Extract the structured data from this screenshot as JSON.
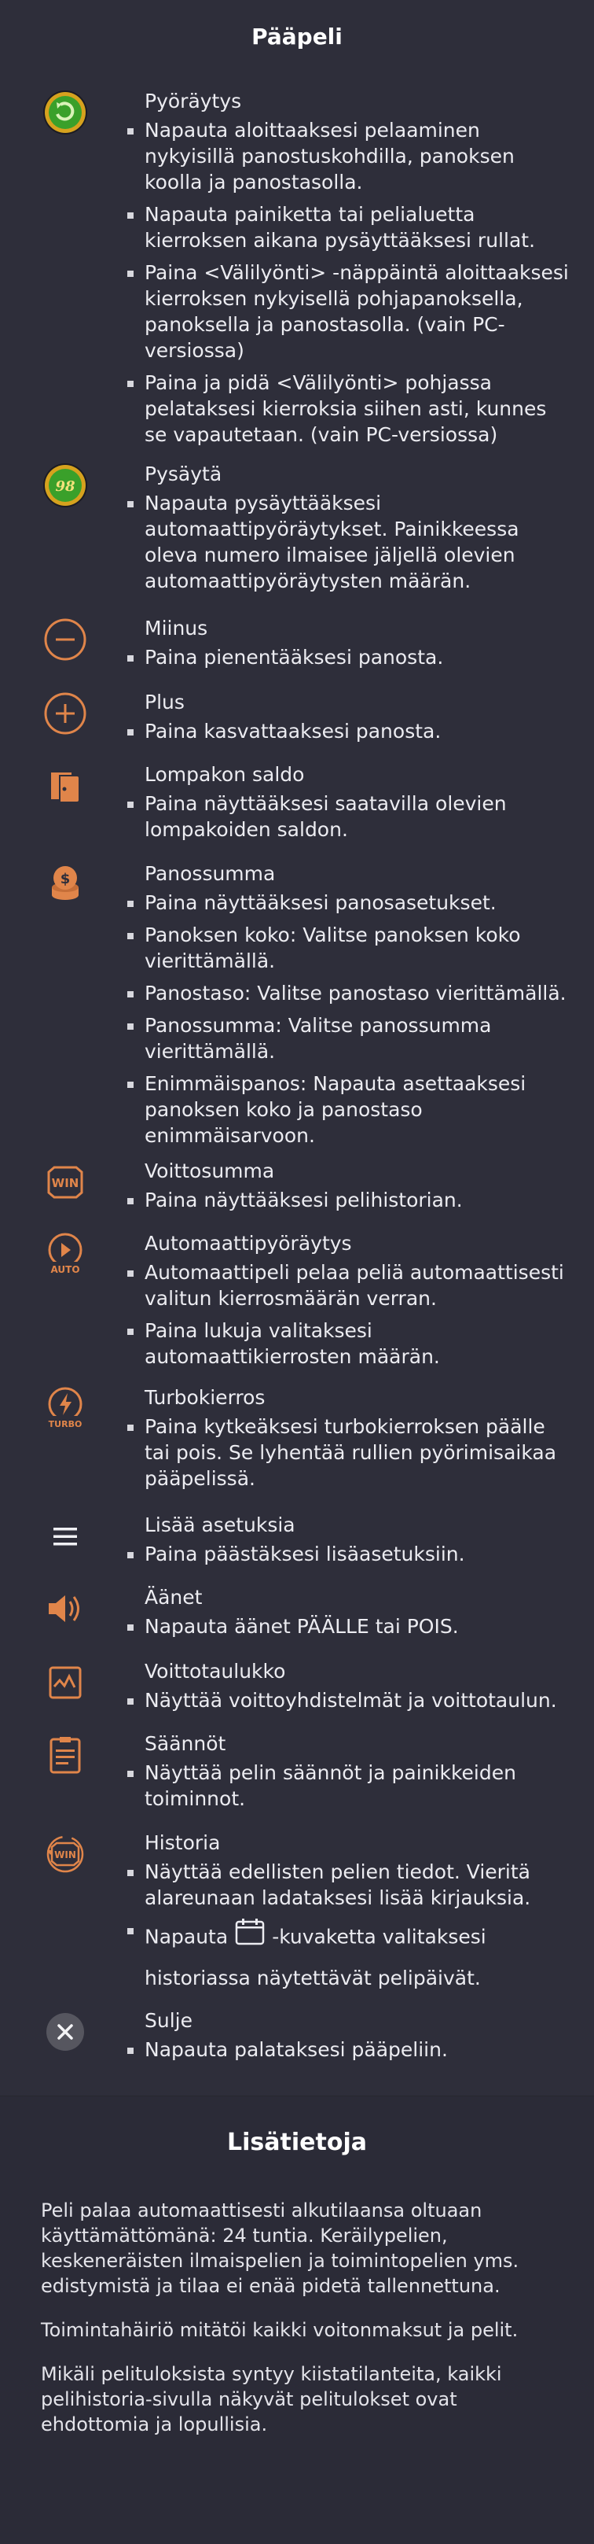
{
  "main": {
    "title": "Pääpeli",
    "sections": [
      {
        "icon": "spin-icon",
        "title": "Pyöräytys",
        "items": [
          "Napauta aloittaaksesi pelaaminen nykyisillä panostuskohdilla, panoksen koolla ja panostasolla.",
          "Napauta painiketta tai pelialuetta kierroksen aikana pysäyttääksesi rullat.",
          "Paina <Välilyönti> -näppäintä aloittaaksesi kierroksen nykyisellä pohjapanoksella, panoksella ja panostasolla. (vain PC-versiossa)",
          "Paina ja pidä <Välilyönti> pohjassa pelataksesi kierroksia siihen asti, kunnes se vapautetaan. (vain PC-versiossa)"
        ]
      },
      {
        "icon": "stop-autospin-icon",
        "icon_text": "98",
        "title": "Pysäytä",
        "items": [
          "Napauta pysäyttääksesi automaattipyöräytykset. Painikkeessa oleva numero ilmaisee jäljellä olevien automaattipyöräytysten määrän."
        ]
      },
      {
        "icon": "minus-icon",
        "title": "Miinus",
        "items": [
          "Paina pienentääksesi panosta."
        ]
      },
      {
        "icon": "plus-icon",
        "title": "Plus",
        "items": [
          "Paina kasvattaaksesi panosta."
        ]
      },
      {
        "icon": "wallet-icon",
        "title": "Lompakon saldo",
        "items": [
          "Paina näyttääksesi saatavilla olevien lompakoiden saldon."
        ]
      },
      {
        "icon": "coins-icon",
        "title": "Panossumma",
        "items": [
          "Paina näyttääksesi panosasetukset.",
          "Panoksen koko: Valitse panoksen koko vierittämällä.",
          "Panostaso: Valitse panostaso vierittämällä.",
          "Panossumma: Valitse panossumma vierittämällä.",
          "Enimmäispanos: Napauta asettaaksesi panoksen koko ja panostaso enimmäisarvoon."
        ]
      },
      {
        "icon": "win-icon",
        "icon_text": "WIN",
        "title": "Voittosumma",
        "items": [
          "Paina näyttääksesi pelihistorian."
        ]
      },
      {
        "icon": "autoplay-icon",
        "icon_text": "AUTO",
        "title": "Automaattipyöräytys",
        "items": [
          "Automaattipeli pelaa peliä automaattisesti valitun kierrosmäärän verran.",
          "Paina lukuja valitaksesi automaattikierrosten määrän."
        ]
      },
      {
        "icon": "turbo-icon",
        "icon_text": "TURBO",
        "title": "Turbokierros",
        "items": [
          "Paina kytkeäksesi turbokierroksen päälle tai pois. Se lyhentää rullien pyörimisaikaa pääpelissä."
        ]
      },
      {
        "icon": "menu-icon",
        "title": "Lisää asetuksia",
        "items": [
          "Paina päästäksesi lisäasetuksiin."
        ]
      },
      {
        "icon": "sound-icon",
        "title": "Äänet",
        "items": [
          "Napauta äänet PÄÄLLE tai POIS."
        ]
      },
      {
        "icon": "paytable-icon",
        "title": "Voittotaulukko",
        "items": [
          "Näyttää voittoyhdistelmät ja voittotaulun."
        ]
      },
      {
        "icon": "rules-icon",
        "title": "Säännöt",
        "items": [
          "Näyttää pelin säännöt ja painikkeiden toiminnot."
        ]
      },
      {
        "icon": "history-icon",
        "icon_text": "WIN",
        "title": "Historia",
        "items": [
          "Näyttää edellisten pelien tiedot. Vieritä alareunaan ladataksesi lisää kirjauksia."
        ],
        "calendar_item_before": "Napauta",
        "calendar_item_after": "-kuvaketta valitaksesi historiassa näytettävät pelipäivät."
      },
      {
        "icon": "close-icon",
        "title": "Sulje",
        "items": [
          "Napauta palataksesi pääpeliin."
        ]
      }
    ]
  },
  "extra": {
    "title": "Lisätietoja",
    "paragraphs": [
      "Peli palaa automaattisesti alkutilaansa oltuaan käyttämättömänä: 24 tuntia. Keräilypelien, keskeneräisten ilmaispelien ja toimintopelien yms. edistymistä ja tilaa ei enää pidetä tallennettuna.",
      "Toimintahäiriö mitätöi kaikki voitonmaksut ja pelit.",
      "Mikäli pelituloksista syntyy kiistatilanteita, kaikki pelihistoria-sivulla näkyvät pelitulokset ovat ehdottomia ja lopullisia."
    ]
  },
  "colors": {
    "background": "#2e2e3a",
    "icon_accent": "#e0854a",
    "spin_green": "#3aa02a",
    "gold": "#d6a21e"
  }
}
